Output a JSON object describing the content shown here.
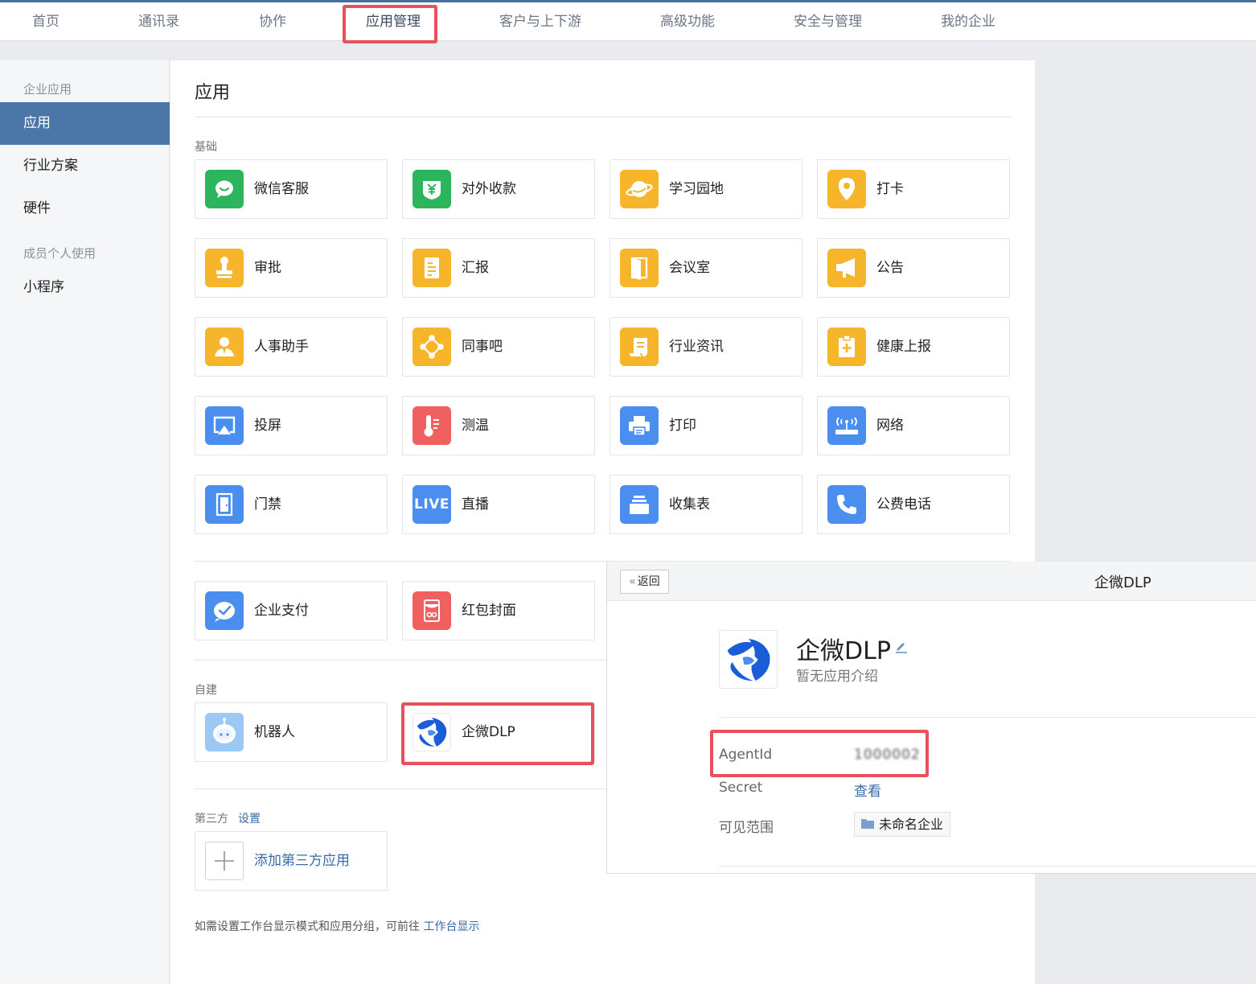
{
  "topnav": {
    "items": [
      "首页",
      "通讯录",
      "协作",
      "应用管理",
      "客户与上下游",
      "高级功能",
      "安全与管理",
      "我的企业"
    ],
    "active": "应用管理"
  },
  "sidebar": {
    "group_enterprise": "企业应用",
    "item_apps": "应用",
    "item_industry": "行业方案",
    "item_hardware": "硬件",
    "group_personal": "成员个人使用",
    "item_miniprogram": "小程序"
  },
  "main": {
    "title": "应用",
    "section_basic": "基础",
    "basic_apps": [
      {
        "label": "微信客服",
        "icon": "chat-bubble-icon",
        "color": "#2db55d"
      },
      {
        "label": "对外收款",
        "icon": "yuan-shield-icon",
        "color": "#2db55d"
      },
      {
        "label": "学习园地",
        "icon": "planet-icon",
        "color": "#f7b52b"
      },
      {
        "label": "打卡",
        "icon": "location-pin-icon",
        "color": "#f7b52b"
      },
      {
        "label": "审批",
        "icon": "stamp-icon",
        "color": "#f7b52b"
      },
      {
        "label": "汇报",
        "icon": "report-document-icon",
        "color": "#f7b52b"
      },
      {
        "label": "会议室",
        "icon": "door-icon",
        "color": "#f7b52b"
      },
      {
        "label": "公告",
        "icon": "megaphone-icon",
        "color": "#f7b52b"
      },
      {
        "label": "人事助手",
        "icon": "person-icon",
        "color": "#f7b52b"
      },
      {
        "label": "同事吧",
        "icon": "network-nodes-icon",
        "color": "#f7b52b"
      },
      {
        "label": "行业资讯",
        "icon": "scroll-icon",
        "color": "#f7b52b"
      },
      {
        "label": "健康上报",
        "icon": "medical-clipboard-icon",
        "color": "#f7b52b"
      },
      {
        "label": "投屏",
        "icon": "airplay-icon",
        "color": "#4a8ef0"
      },
      {
        "label": "测温",
        "icon": "thermometer-icon",
        "color": "#f0605e"
      },
      {
        "label": "打印",
        "icon": "printer-icon",
        "color": "#4a8ef0"
      },
      {
        "label": "网络",
        "icon": "router-icon",
        "color": "#4a8ef0"
      },
      {
        "label": "门禁",
        "icon": "access-door-icon",
        "color": "#4a8ef0"
      },
      {
        "label": "直播",
        "icon": "live-icon",
        "color": "#4a8ef0"
      },
      {
        "label": "收集表",
        "icon": "form-stack-icon",
        "color": "#4a8ef0"
      },
      {
        "label": "公费电话",
        "icon": "phone-icon",
        "color": "#4a8ef0"
      }
    ],
    "live_text": "LIVE",
    "extra_apps": [
      {
        "label": "企业支付",
        "icon": "payment-check-icon",
        "color": "#4a8ef0"
      },
      {
        "label": "红包封面",
        "icon": "red-envelope-icon",
        "color": "#f0605e"
      }
    ],
    "section_custom": "自建",
    "custom_apps": [
      {
        "label": "机器人",
        "icon": "robot-icon"
      },
      {
        "label": "企微DLP",
        "icon": "dlp-logo-icon"
      }
    ],
    "section_third": "第三方",
    "third_settings": "设置",
    "add_third": "添加第三方应用",
    "footer_text": "如需设置工作台显示模式和应用分组，可前往",
    "footer_link": "工作台显示"
  },
  "detail": {
    "back_label": "返回",
    "header_title": "企微DLP",
    "app_name": "企微DLP",
    "app_desc": "暂无应用介绍",
    "agentid_label": "AgentId",
    "agentid_value": "1000002",
    "secret_label": "Secret",
    "secret_link": "查看",
    "scope_label": "可见范围",
    "scope_value": "未命名企业"
  },
  "colors": {
    "highlight": "#e8505b",
    "accent": "#4a76a8",
    "link": "#3a6aa8"
  }
}
